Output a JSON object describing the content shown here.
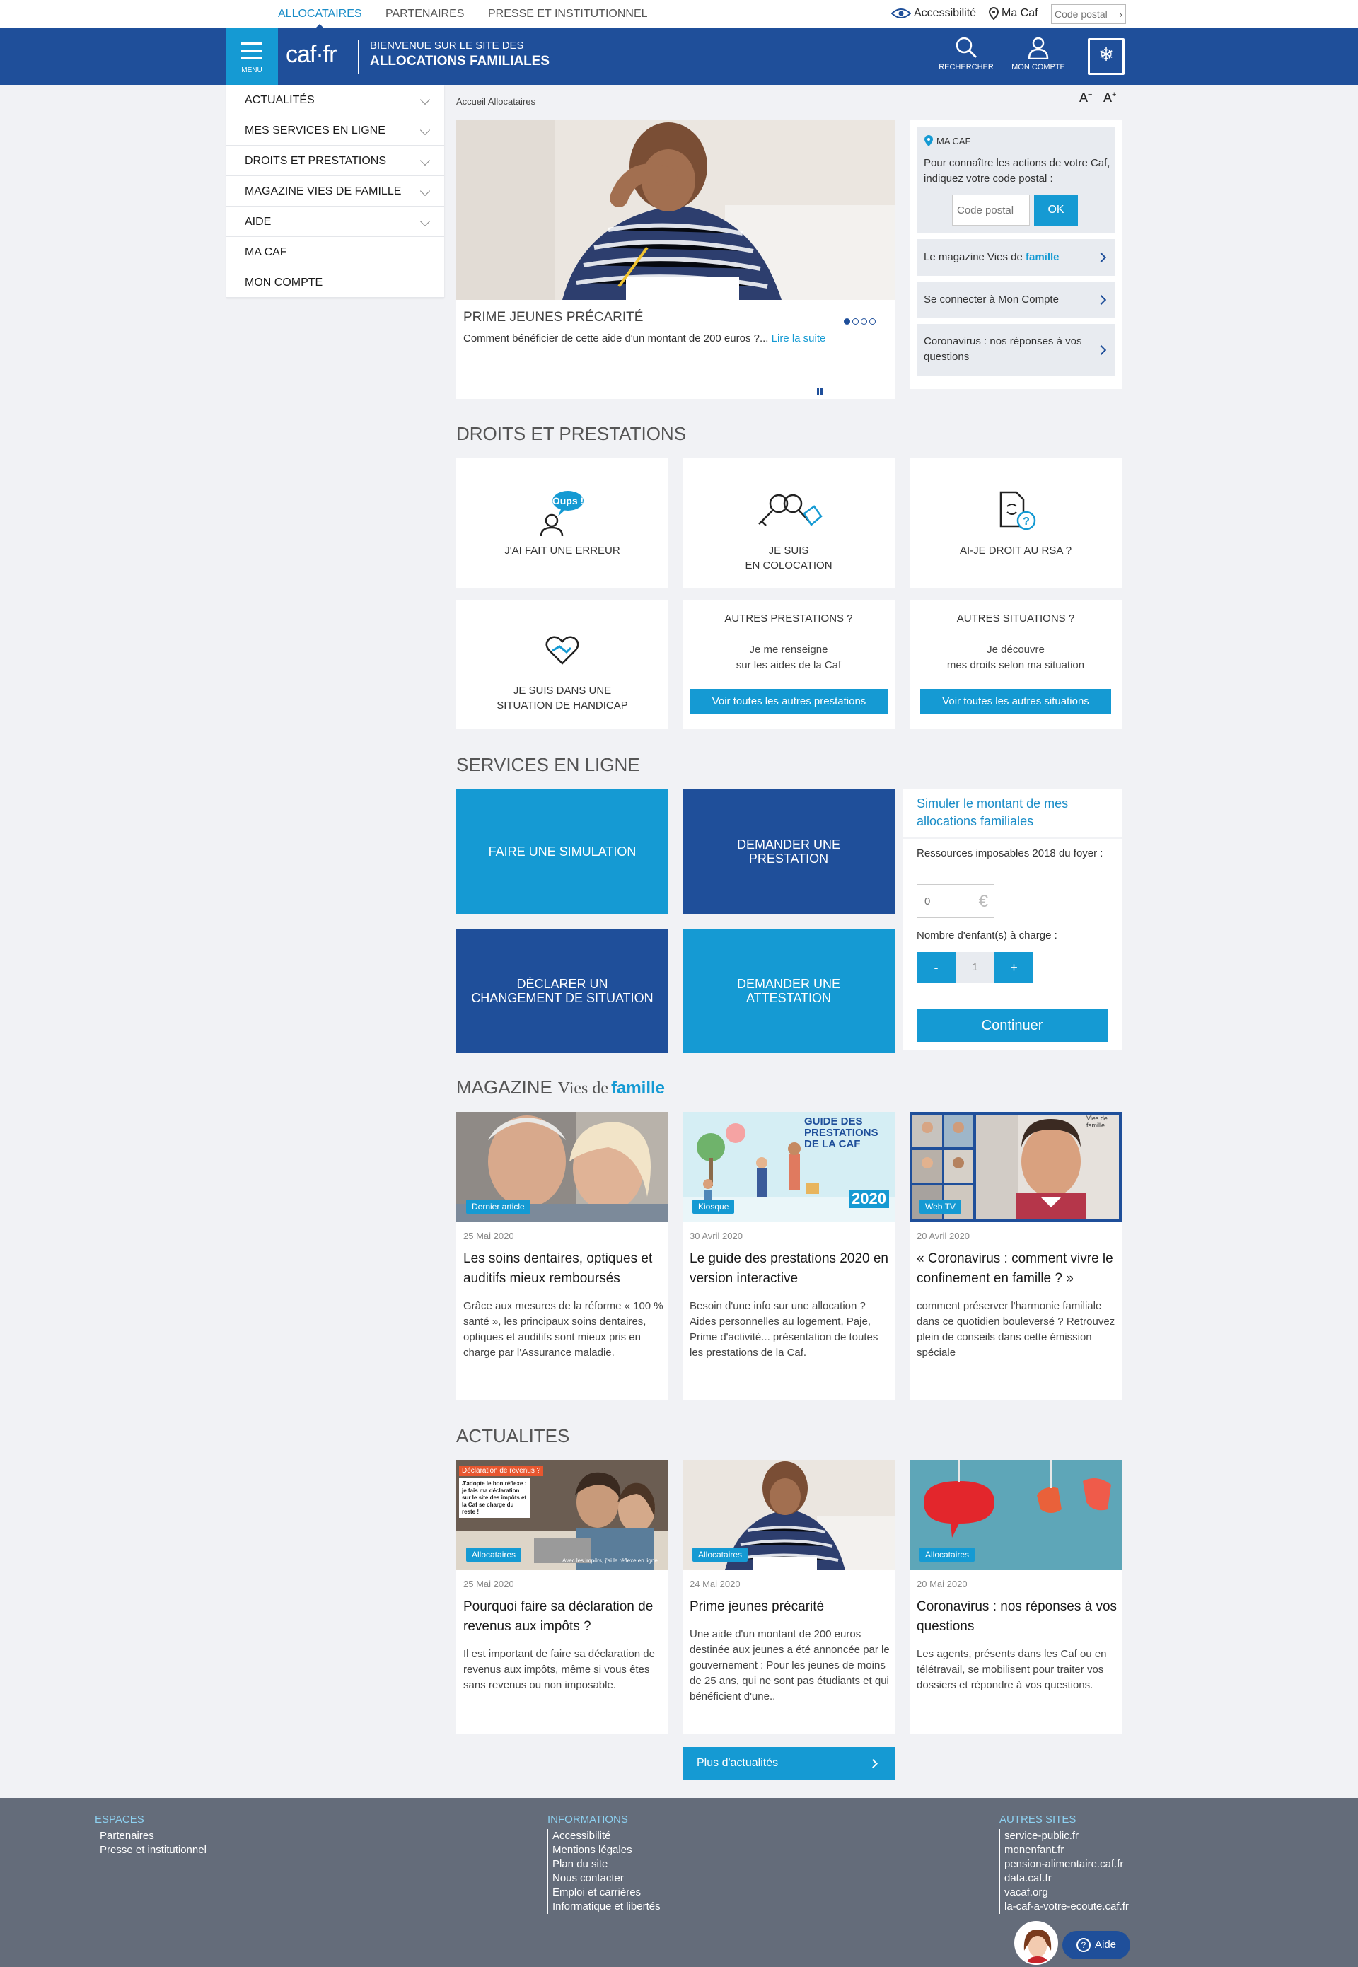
{
  "topbar": {
    "tabs": [
      "ALLOCATAIRES",
      "PARTENAIRES",
      "PRESSE ET INSTITUTIONNEL"
    ],
    "accessibility": "Accessibilité",
    "macaf": "Ma Caf",
    "postal_placeholder": "Code postal"
  },
  "header": {
    "menu_label": "MENU",
    "logo": "caf·fr",
    "tagline_1": "BIENVENUE SUR LE SITE DES",
    "tagline_2": "ALLOCATIONS FAMILIALES",
    "search_label": "RECHERCHER",
    "account_label": "MON COMPTE"
  },
  "sidemenu": [
    {
      "label": "ACTUALITÉS",
      "expandable": true
    },
    {
      "label": "MES SERVICES EN LIGNE",
      "expandable": true
    },
    {
      "label": "DROITS ET PRESTATIONS",
      "expandable": true
    },
    {
      "label": "MAGAZINE VIES DE FAMILLE",
      "expandable": true
    },
    {
      "label": "AIDE",
      "expandable": true
    },
    {
      "label": "MA CAF",
      "expandable": false
    },
    {
      "label": "MON COMPTE",
      "expandable": false
    }
  ],
  "breadcrumb": "Accueil Allocataires",
  "font_controls": {
    "smaller": "A",
    "larger": "A"
  },
  "hero": {
    "title": "PRIME JEUNES PRÉCARITÉ",
    "text": "Comment bénéficier de cette aide d'un montant de 200 euros ?...",
    "link": "Lire la suite",
    "slides": 4,
    "active_slide": 1
  },
  "macaf_panel": {
    "heading": "MA CAF",
    "text": "Pour connaître les actions de votre Caf, indiquez votre code postal :",
    "postal_placeholder": "Code postal",
    "ok": "OK",
    "links": [
      {
        "pre": "Le magazine Vies de ",
        "bold": "famille"
      },
      {
        "pre": "Se connecter à Mon Compte",
        "bold": ""
      },
      {
        "pre": "Coronavirus : nos réponses à vos questions",
        "bold": ""
      }
    ]
  },
  "droits": {
    "title": "DROITS ET PRESTATIONS",
    "tiles": [
      {
        "label": "J'AI FAIT UNE ERREUR",
        "bubble": "Oups !"
      },
      {
        "label_1": "JE SUIS",
        "label_2": "EN COLOCATION"
      },
      {
        "label": "AI-JE DROIT AU RSA ?"
      },
      {
        "label_1": "JE SUIS DANS UNE",
        "label_2": "SITUATION DE HANDICAP"
      }
    ],
    "autres_prestations": {
      "title": "AUTRES PRESTATIONS ?",
      "text_1": "Je me renseigne",
      "text_2": "sur les aides de la Caf",
      "button": "Voir toutes les autres prestations"
    },
    "autres_situations": {
      "title": "AUTRES SITUATIONS ?",
      "text_1": "Je découvre",
      "text_2": "mes droits selon ma situation",
      "button": "Voir toutes les autres situations"
    }
  },
  "services": {
    "title": "SERVICES EN LIGNE",
    "tiles": [
      "FAIRE UNE SIMULATION",
      "DEMANDER UNE PRESTATION",
      "DÉCLARER UN CHANGEMENT DE SITUATION",
      "DEMANDER UNE ATTESTATION"
    ],
    "simulator": {
      "title": "Simuler le montant de mes allocations familiales",
      "resources_label": "Ressources imposables 2018 du foyer :",
      "resources_placeholder": "0",
      "currency": "€",
      "children_label": "Nombre d'enfant(s) à charge :",
      "minus": "-",
      "children_value": "1",
      "plus": "+",
      "submit": "Continuer"
    }
  },
  "magazine": {
    "title_1": "MAGAZINE",
    "title_2": "Vies de",
    "title_3": "famille",
    "articles": [
      {
        "tag": "Dernier article",
        "date": "25 Mai 2020",
        "title": "Les soins dentaires, optiques et auditifs mieux remboursés",
        "desc": "Grâce aux mesures de la réforme « 100 % santé », les principaux soins dentaires, optiques et auditifs sont mieux pris en charge par l'Assurance maladie."
      },
      {
        "tag": "Kiosque",
        "date": "30 Avril 2020",
        "title": "Le guide des prestations 2020 en version interactive",
        "desc": "Besoin d'une info sur une allocation ? Aides personnelles au logement, Paje, Prime d'activité... présentation de toutes les prestations de la Caf.",
        "img_title": "GUIDE DES PRESTATIONS DE LA CAF",
        "img_year": "2020"
      },
      {
        "tag": "Web TV",
        "date": "20 Avril 2020",
        "title": "« Coronavirus : comment vivre le confinement en famille ? »",
        "desc": "comment préserver l'harmonie familiale dans ce quotidien bouleversé ? Retrouvez plein de conseils dans cette émission spéciale",
        "img_brand": "Vies de famille"
      }
    ]
  },
  "actualites": {
    "title": "ACTUALITES",
    "articles": [
      {
        "tag": "Allocataires",
        "date": "25 Mai 2020",
        "title": "Pourquoi faire sa déclaration de revenus aux impôts ?",
        "desc": "Il est important de faire sa déclaration de revenus aux impôts, même si vous êtes sans revenus ou non imposable.",
        "img_banner": "Déclaration de revenus ?",
        "img_note": "J'adopte le bon réflexe : je fais ma déclaration sur le site des impôts et la Caf se charge du reste !",
        "img_footer": "Avec les impôts, j'ai le réflexe en ligne"
      },
      {
        "tag": "Allocataires",
        "date": "24 Mai 2020",
        "title": "Prime jeunes précarité",
        "desc": "Une aide d'un montant de 200 euros destinée aux jeunes a été annoncée par le gouvernement : Pour les jeunes de moins de 25 ans, qui ne sont pas étudiants et qui bénéficient d'une.."
      },
      {
        "tag": "Allocataires",
        "date": "20 Mai 2020",
        "title": "Coronavirus : nos réponses à vos questions",
        "desc": "Les agents, présents dans les Caf ou en télétravail, se mobilisent pour traiter vos dossiers et répondre à vos questions."
      }
    ],
    "more": "Plus d'actualités"
  },
  "footer": {
    "espaces": {
      "title": "ESPACES",
      "links": [
        "Partenaires",
        "Presse et institutionnel"
      ]
    },
    "informations": {
      "title": "INFORMATIONS",
      "links": [
        "Accessibilité",
        "Mentions légales",
        "Plan du site",
        "Nous contacter",
        "Emploi et carrières",
        "Informatique et libertés"
      ]
    },
    "autres": {
      "title": "AUTRES SITES",
      "links": [
        "service-public.fr",
        "monenfant.fr",
        "pension-alimentaire.caf.fr",
        "data.caf.fr",
        "vacaf.org",
        "la-caf-a-votre-ecoute.caf.fr"
      ]
    },
    "help": "Aide"
  },
  "colors": {
    "primary": "#1f4f9a",
    "accent": "#159ad3",
    "bg": "#f1f2f5",
    "footer": "#646c7a"
  }
}
